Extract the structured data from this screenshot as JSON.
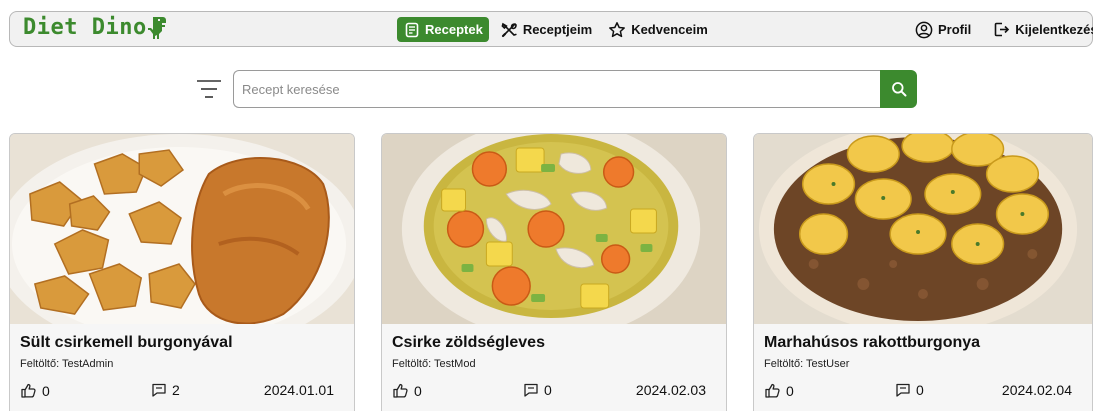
{
  "brand": {
    "name": "Diet Dino"
  },
  "nav": {
    "items": [
      {
        "label": "Receptek",
        "icon": "recipe-book-icon",
        "active": true
      },
      {
        "label": "Receptjeim",
        "icon": "utensils-cross-icon",
        "active": false
      },
      {
        "label": "Kedvenceim",
        "icon": "star-icon",
        "active": false
      }
    ],
    "profile_label": "Profil",
    "logout_label": "Kijelentkezés"
  },
  "search": {
    "placeholder": "Recept keresése"
  },
  "colors": {
    "brand_green": "#3c8a2e",
    "nav_bg": "#f1f1f1",
    "card_bg": "#f6f6f6"
  },
  "recipes": [
    {
      "title": "Sült csirkemell burgonyával",
      "uploader": "Feltöltő: TestAdmin",
      "likes": "0",
      "comments": "2",
      "date": "2024.01.01"
    },
    {
      "title": "Csirke zöldségleves",
      "uploader": "Feltöltő: TestMod",
      "likes": "0",
      "comments": "0",
      "date": "2024.02.03"
    },
    {
      "title": "Marhahúsos rakottburgonya",
      "uploader": "Feltöltő: TestUser",
      "likes": "0",
      "comments": "0",
      "date": "2024.02.04"
    }
  ]
}
